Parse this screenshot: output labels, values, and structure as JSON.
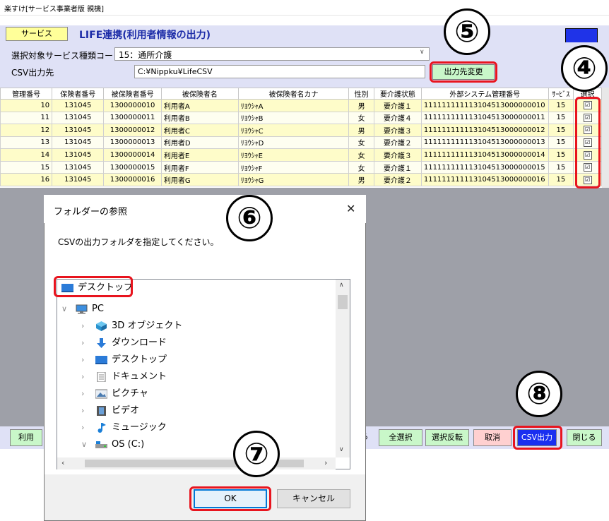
{
  "window": {
    "title": "楽すけ[サービス事業者版 親機]",
    "service_button": "サービス",
    "screen_title": "LIFE連携(利用者情報の出力)"
  },
  "params": {
    "service_type_label": "選択対象サービス種類コード",
    "service_type_value": "15：通所介護",
    "csv_label": "CSV出力先",
    "csv_path": "C:¥Nippku¥LifeCSV",
    "change_dest_button": "出力先変更"
  },
  "table": {
    "columns": [
      "管理番号",
      "保険者番号",
      "被保険者番号",
      "被保険者名",
      "被保険者名カナ",
      "性別",
      "要介護状態",
      "外部システム管理番号",
      "ｻｰﾋﾞｽ",
      "選択"
    ],
    "rows": [
      [
        "10",
        "131045",
        "1300000010",
        "利用者A",
        "ﾘﾖｳｼｬA",
        "男",
        "要介護１",
        "111111111113104513000000010",
        "15",
        "☑"
      ],
      [
        "11",
        "131045",
        "1300000011",
        "利用者B",
        "ﾘﾖｳｼｬB",
        "女",
        "要介護４",
        "111111111113104513000000011",
        "15",
        "☑"
      ],
      [
        "12",
        "131045",
        "1300000012",
        "利用者C",
        "ﾘﾖｳｼｬC",
        "男",
        "要介護３",
        "111111111113104513000000012",
        "15",
        "☑"
      ],
      [
        "13",
        "131045",
        "1300000013",
        "利用者D",
        "ﾘﾖｳｼｬD",
        "女",
        "要介護２",
        "111111111113104513000000013",
        "15",
        "☑"
      ],
      [
        "14",
        "131045",
        "1300000014",
        "利用者E",
        "ﾘﾖｳｼｬE",
        "女",
        "要介護３",
        "111111111113104513000000014",
        "15",
        "☑"
      ],
      [
        "15",
        "131045",
        "1300000015",
        "利用者F",
        "ﾘﾖｳｼｬF",
        "女",
        "要介護１",
        "111111111113104513000000015",
        "15",
        "☑"
      ],
      [
        "16",
        "131045",
        "1300000016",
        "利用者G",
        "ﾘﾖｳｼｬG",
        "男",
        "要介護２",
        "111111111113104513000000016",
        "15",
        "☑"
      ]
    ]
  },
  "footer": {
    "left_button_partial": "利用",
    "partial_text": "ら",
    "select_all": "全選択",
    "invert": "選択反転",
    "cancel": "取消",
    "csv_output": "CSV出力",
    "close": "閉じる"
  },
  "dialog": {
    "title": "フォルダーの参照",
    "close_glyph": "✕",
    "message": "CSVの出力フォルダを指定してください。",
    "tree": [
      {
        "label": "デスクトップ",
        "icon": "desktop-icon",
        "chevron": ""
      },
      {
        "label": "PC",
        "icon": "pc-icon",
        "chevron": "∨"
      },
      {
        "label": "3D オブジェクト",
        "icon": "3d-objects-icon",
        "chevron": "›"
      },
      {
        "label": "ダウンロード",
        "icon": "download-icon",
        "chevron": "›"
      },
      {
        "label": "デスクトップ",
        "icon": "desktop-icon",
        "chevron": "›"
      },
      {
        "label": "ドキュメント",
        "icon": "document-icon",
        "chevron": "›"
      },
      {
        "label": "ピクチャ",
        "icon": "pictures-icon",
        "chevron": "›"
      },
      {
        "label": "ビデオ",
        "icon": "video-icon",
        "chevron": "›"
      },
      {
        "label": "ミュージック",
        "icon": "music-icon",
        "chevron": "›"
      },
      {
        "label": "OS (C:)",
        "icon": "drive-icon",
        "chevron": "∨"
      }
    ],
    "ok": "OK",
    "cancel": "キャンセル"
  },
  "annotations": [
    "④",
    "⑤",
    "⑥",
    "⑦",
    "⑧"
  ],
  "colors": {
    "highlight_red": "#e8141e",
    "header_lavender": "#dfe1f6",
    "title_blue": "#1d2ca8",
    "csv_button_blue": "#1a2ff0",
    "green_button": "#c9f7c9"
  }
}
